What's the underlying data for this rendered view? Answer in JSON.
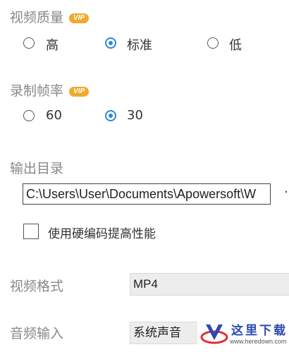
{
  "video_quality": {
    "title": "视频质量",
    "badge": "VIP",
    "options": [
      {
        "label": "高",
        "checked": false
      },
      {
        "label": "标准",
        "checked": true
      },
      {
        "label": "低",
        "checked": false
      }
    ]
  },
  "frame_rate": {
    "title": "录制帧率",
    "badge": "VIP",
    "options": [
      {
        "label": "60",
        "checked": false
      },
      {
        "label": "30",
        "checked": true
      }
    ]
  },
  "output_dir": {
    "title": "输出目录",
    "path": "C:\\Users\\User\\Documents\\Apowersoft\\W",
    "more_label": "·"
  },
  "hw_encoding": {
    "label": "使用硬编码提高性能",
    "checked": false
  },
  "video_format": {
    "title": "视频格式",
    "value": "MP4"
  },
  "audio_input": {
    "title": "音频输入",
    "value": "系统声音"
  },
  "watermark": {
    "text": "这里下载",
    "url": "www.heredown.com"
  },
  "colors": {
    "accent": "#2a8ad8",
    "vip": "#f0a92a",
    "label_gray": "#888888"
  }
}
